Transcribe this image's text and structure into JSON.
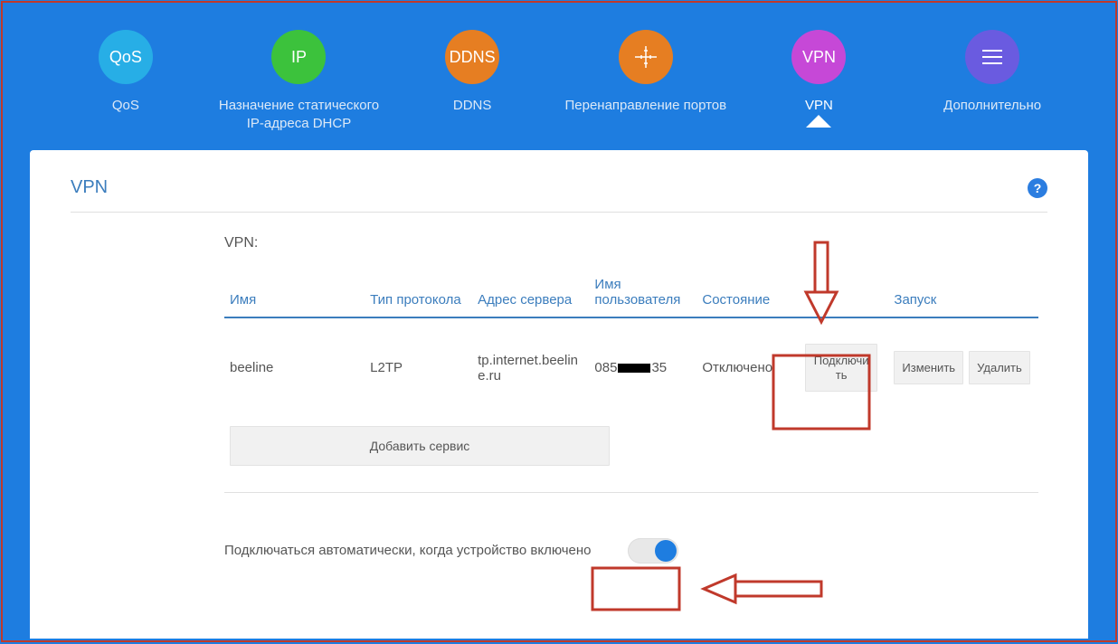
{
  "nav": {
    "items": [
      {
        "id": "qos",
        "label": "QoS",
        "circle_text": "QoS"
      },
      {
        "id": "ip",
        "label": "Назначение статического\nIP-адреса DHCP",
        "circle_text": "IP"
      },
      {
        "id": "ddns",
        "label": "DDNS",
        "circle_text": "DDNS"
      },
      {
        "id": "pf",
        "label": "Перенаправление портов",
        "circle_text": ""
      },
      {
        "id": "vpn",
        "label": "VPN",
        "circle_text": "VPN",
        "active": true
      },
      {
        "id": "more",
        "label": "Дополнительно",
        "circle_text": ""
      }
    ]
  },
  "panel": {
    "title": "VPN",
    "help_symbol": "?",
    "section_label": "VPN:"
  },
  "table": {
    "headers": {
      "name": "Имя",
      "protocol": "Тип протокола",
      "server": "Адрес сервера",
      "user": "Имя пользователя",
      "state": "Состояние",
      "blank": "",
      "launch": "Запуск"
    },
    "row": {
      "name": "beeline",
      "protocol": "L2TP",
      "server": "tp.internet.beeline.ru",
      "user_prefix": "085",
      "user_suffix": "35",
      "state": "Отключено"
    },
    "buttons": {
      "connect": "Подключить",
      "edit": "Изменить",
      "delete": "Удалить",
      "add": "Добавить сервис"
    }
  },
  "auto_connect": {
    "label": "Подключаться автоматически, когда устройство включено",
    "enabled": true
  },
  "colors": {
    "accent": "#1e7de0",
    "annotation": "#c0392b"
  }
}
